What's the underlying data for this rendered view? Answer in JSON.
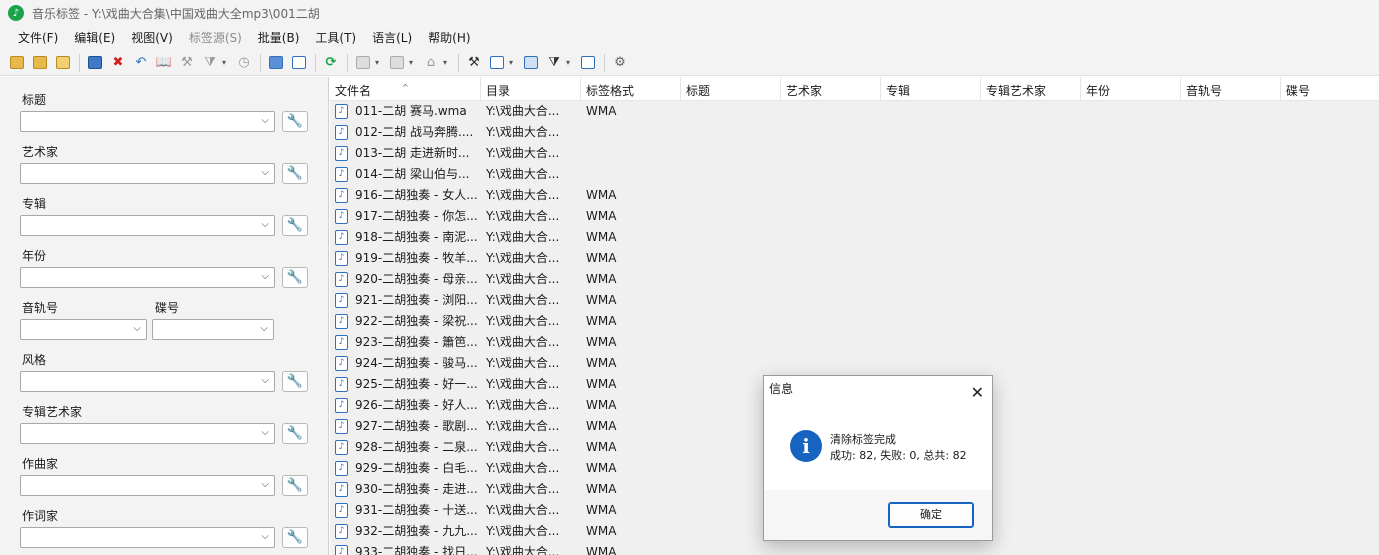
{
  "titlebar": {
    "title": "音乐标签 - Y:\\戏曲大合集\\中国戏曲大全mp3\\001二胡"
  },
  "menu": [
    {
      "label": "文件(F)",
      "enabled": true
    },
    {
      "label": "编辑(E)",
      "enabled": true
    },
    {
      "label": "视图(V)",
      "enabled": true
    },
    {
      "label": "标签源(S)",
      "enabled": false
    },
    {
      "label": "批量(B)",
      "enabled": true
    },
    {
      "label": "工具(T)",
      "enabled": true
    },
    {
      "label": "语言(L)",
      "enabled": true
    },
    {
      "label": "帮助(H)",
      "enabled": true
    }
  ],
  "toolbar_icons": [
    "open-folder-icon",
    "add-folder-icon",
    "add-files-icon",
    "save-icon",
    "delete-tag-icon",
    "undo-icon",
    "read-book-icon",
    "tools-icon",
    "filter-icon",
    "clock-icon",
    "grid-view-icon",
    "table-view-icon",
    "refresh-icon",
    "doc-icon",
    "abc-icon",
    "tag-icon",
    "wand-icon",
    "copy-icon",
    "export-icon",
    "batch-icon",
    "frame-icon",
    "settings-icon"
  ],
  "left_panel": {
    "title_label": "标题",
    "artist_label": "艺术家",
    "album_label": "专辑",
    "year_label": "年份",
    "track_label": "音轨号",
    "disc_label": "碟号",
    "genre_label": "风格",
    "album_artist_label": "专辑艺术家",
    "composer_label": "作曲家",
    "lyricist_label": "作词家"
  },
  "grid": {
    "columns": [
      "文件名",
      "目录",
      "标签格式",
      "标题",
      "艺术家",
      "专辑",
      "专辑艺术家",
      "年份",
      "音轨号",
      "碟号"
    ],
    "rows": [
      {
        "name": "011-二胡 赛马.wma",
        "dir": "Y:\\戏曲大合...",
        "fmt": "WMA"
      },
      {
        "name": "012-二胡 战马奔腾....",
        "dir": "Y:\\戏曲大合...",
        "fmt": ""
      },
      {
        "name": "013-二胡 走进新时...",
        "dir": "Y:\\戏曲大合...",
        "fmt": ""
      },
      {
        "name": "014-二胡 梁山伯与...",
        "dir": "Y:\\戏曲大合...",
        "fmt": ""
      },
      {
        "name": "916-二胡独奏 - 女人...",
        "dir": "Y:\\戏曲大合...",
        "fmt": "WMA"
      },
      {
        "name": "917-二胡独奏 - 你怎...",
        "dir": "Y:\\戏曲大合...",
        "fmt": "WMA"
      },
      {
        "name": "918-二胡独奏 - 南泥...",
        "dir": "Y:\\戏曲大合...",
        "fmt": "WMA"
      },
      {
        "name": "919-二胡独奏 - 牧羊...",
        "dir": "Y:\\戏曲大合...",
        "fmt": "WMA"
      },
      {
        "name": "920-二胡独奏 - 母亲...",
        "dir": "Y:\\戏曲大合...",
        "fmt": "WMA"
      },
      {
        "name": "921-二胡独奏 - 浏阳...",
        "dir": "Y:\\戏曲大合...",
        "fmt": "WMA"
      },
      {
        "name": "922-二胡独奏 - 梁祝...",
        "dir": "Y:\\戏曲大合...",
        "fmt": "WMA"
      },
      {
        "name": "923-二胡独奏 - 簫笆...",
        "dir": "Y:\\戏曲大合...",
        "fmt": "WMA"
      },
      {
        "name": "924-二胡独奏 - 骏马...",
        "dir": "Y:\\戏曲大合...",
        "fmt": "WMA"
      },
      {
        "name": "925-二胡独奏 - 好一...",
        "dir": "Y:\\戏曲大合...",
        "fmt": "WMA"
      },
      {
        "name": "926-二胡独奏 - 好人...",
        "dir": "Y:\\戏曲大合...",
        "fmt": "WMA"
      },
      {
        "name": "927-二胡独奏 - 歌剧...",
        "dir": "Y:\\戏曲大合...",
        "fmt": "WMA"
      },
      {
        "name": "928-二胡独奏 - 二泉...",
        "dir": "Y:\\戏曲大合...",
        "fmt": "WMA"
      },
      {
        "name": "929-二胡独奏 - 白毛...",
        "dir": "Y:\\戏曲大合...",
        "fmt": "WMA"
      },
      {
        "name": "930-二胡独奏 - 走进...",
        "dir": "Y:\\戏曲大合...",
        "fmt": "WMA"
      },
      {
        "name": "931-二胡独奏 - 十送...",
        "dir": "Y:\\戏曲大合...",
        "fmt": "WMA"
      },
      {
        "name": "932-二胡独奏 - 九九...",
        "dir": "Y:\\戏曲大合...",
        "fmt": "WMA"
      },
      {
        "name": "933-二胡独奏 - 找日...",
        "dir": "Y:\\戏曲大合...",
        "fmt": "WMA"
      }
    ]
  },
  "dialog": {
    "title": "信息",
    "line1": "清除标签完成",
    "line2": "成功: 82, 失败: 0, 总共: 82",
    "ok_label": "确定"
  },
  "colors": {
    "accent": "#1664c0",
    "logo": "#1aa34a",
    "delete": "#d42020"
  }
}
